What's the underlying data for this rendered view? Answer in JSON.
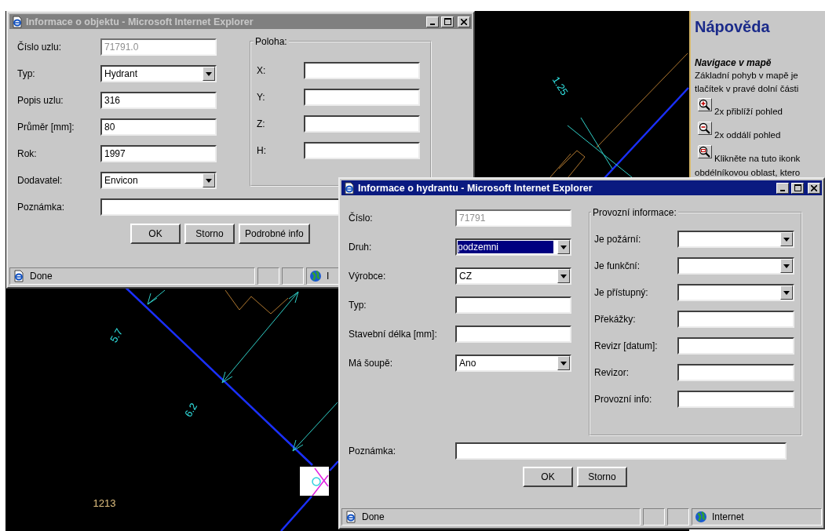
{
  "map": {
    "labels": [
      {
        "text": "1.25",
        "color": "#30e0e0"
      },
      {
        "text": "5.7",
        "color": "#30e0e0"
      },
      {
        "text": "6.2",
        "color": "#30e0e0"
      },
      {
        "text": "1213",
        "color": "#e0c080"
      }
    ]
  },
  "help_panel": {
    "title": "Nápověda",
    "heading": "Navigace v mapě",
    "lines": [
      "Základní pohyb v mapě je",
      "tlačítek v pravé dolní části"
    ],
    "tools": [
      {
        "kind": "zoom_in",
        "text": "2x přiblíží pohled"
      },
      {
        "kind": "zoom_out",
        "text": "2x oddálí pohled"
      },
      {
        "kind": "zoom_box",
        "text": "Klikněte na tuto ikonk"
      }
    ],
    "after": [
      "obdélníkovou oblast, ktero"
    ]
  },
  "windows": [
    {
      "title": "Informace o objektu - Microsoft Internet Explorer",
      "active": false,
      "fields": [
        {
          "label": "Číslo uzlu:",
          "kind": "text",
          "value": "71791.0",
          "disabled": true,
          "highlighted": false
        },
        {
          "label": "Typ:",
          "kind": "select",
          "value": "Hydrant",
          "disabled": false,
          "highlighted": false
        },
        {
          "label": "Popis uzlu:",
          "kind": "text",
          "value": "316",
          "disabled": false,
          "highlighted": false
        },
        {
          "label": "Průměr [mm]:",
          "kind": "text",
          "value": "80",
          "disabled": false,
          "highlighted": false
        },
        {
          "label": "Rok:",
          "kind": "text",
          "value": "1997",
          "disabled": false,
          "highlighted": false
        },
        {
          "label": "Dodavatel:",
          "kind": "select",
          "value": "Envicon",
          "disabled": false,
          "highlighted": false
        }
      ],
      "group": {
        "legend": "Poloha:",
        "fields": [
          {
            "label": "X:",
            "kind": "text",
            "disabled": false,
            "highlighted": false
          },
          {
            "label": "Y:",
            "kind": "text",
            "disabled": false,
            "highlighted": false
          },
          {
            "label": "Z:",
            "kind": "text",
            "disabled": false,
            "highlighted": false
          },
          {
            "label": "H:",
            "kind": "text",
            "disabled": false,
            "highlighted": false
          }
        ]
      },
      "note": {
        "label": "Poznámka:"
      },
      "buttons": [
        "OK",
        "Storno",
        "Podrobné info"
      ],
      "status": {
        "text": "Done",
        "zone": "I"
      }
    },
    {
      "title": "Informace o hydrantu - Microsoft Internet Explorer",
      "active": true,
      "fields": [
        {
          "label": "Číslo:",
          "kind": "text",
          "value": "71791",
          "disabled": true,
          "highlighted": false
        },
        {
          "label": "Druh:",
          "kind": "select",
          "value": "podzemni",
          "disabled": false,
          "highlighted": true
        },
        {
          "label": "Výrobce:",
          "kind": "select",
          "value": "CZ",
          "disabled": false,
          "highlighted": false
        },
        {
          "label": "Typ:",
          "kind": "text",
          "disabled": false,
          "highlighted": false
        },
        {
          "label": "Stavební délka [mm]:",
          "kind": "text",
          "disabled": false,
          "highlighted": false
        },
        {
          "label": "Má šoupě:",
          "kind": "select",
          "value": "Ano",
          "disabled": false,
          "highlighted": false
        }
      ],
      "group": {
        "legend": "Provozní informace:",
        "fields": [
          {
            "label": "Je požární:",
            "kind": "select",
            "disabled": false,
            "highlighted": false
          },
          {
            "label": "Je funkční:",
            "kind": "select",
            "disabled": false,
            "highlighted": false
          },
          {
            "label": "Je přístupný:",
            "kind": "select",
            "disabled": false,
            "highlighted": false
          },
          {
            "label": "Překážky:",
            "kind": "text",
            "disabled": false,
            "highlighted": false
          },
          {
            "label": "Revizr [datum]:",
            "kind": "text",
            "disabled": false,
            "highlighted": false
          },
          {
            "label": "Revizor:",
            "kind": "text",
            "disabled": false,
            "highlighted": false
          },
          {
            "label": "Provozní info:",
            "kind": "text",
            "disabled": false,
            "highlighted": false
          }
        ]
      },
      "note": {
        "label": "Poznámka:"
      },
      "buttons": [
        "OK",
        "Storno"
      ],
      "status": {
        "text": "Done",
        "zone": "Internet"
      }
    }
  ]
}
